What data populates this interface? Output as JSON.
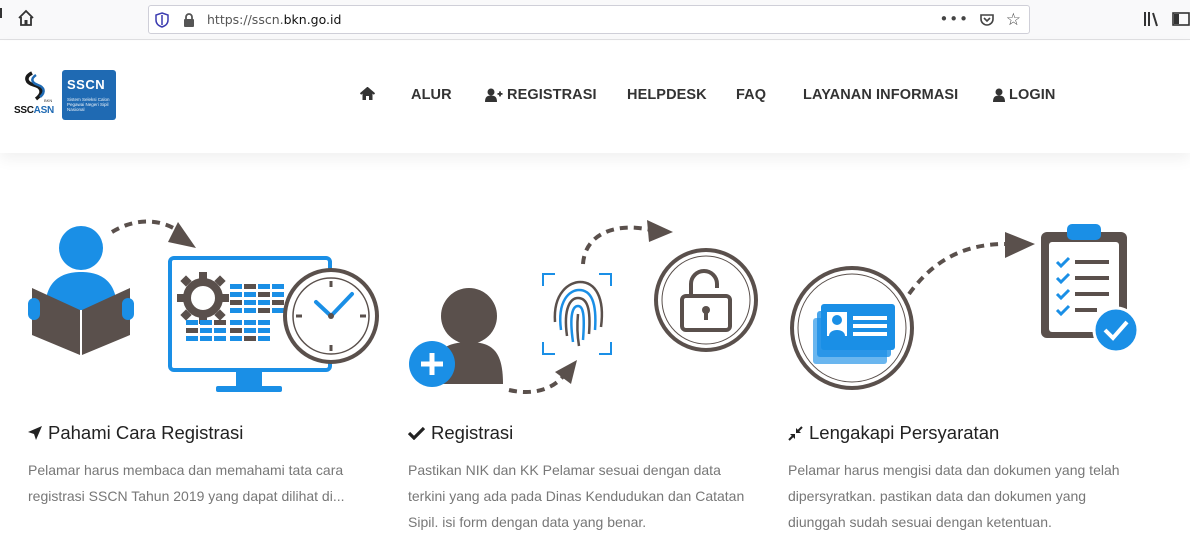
{
  "browser": {
    "url_prefix": "https://sscn.",
    "url_domain": "bkn.go.id",
    "more_label": "•••",
    "bookmark_icon": "star-icon"
  },
  "logos": {
    "sscasn_caption_left": "SSC",
    "sscasn_caption_right": "ASN",
    "sscn_title": "SSCN",
    "sscn_subtitle": "Sistem Seleksi Calon Pegawai Negeri Sipil Nasional"
  },
  "nav": {
    "home_icon": "home-icon",
    "items": [
      {
        "label": "ALUR"
      },
      {
        "label": "REGISTRASI",
        "icon": "user-plus-icon"
      },
      {
        "label": "HELPDESK"
      },
      {
        "label": "FAQ"
      },
      {
        "label": "LAYANAN INFORMASI"
      },
      {
        "label": "LOGIN",
        "icon": "user-icon"
      }
    ]
  },
  "colors": {
    "brand_blue": "#1f6ab3",
    "accent_blue": "#1a8fe6",
    "dark_gray": "#5a504c",
    "text_gray": "#777777"
  },
  "steps": [
    {
      "icon": "paper-plane-icon",
      "title": "Pahami Cara Registrasi",
      "description": "Pelamar harus membaca dan memahami tata cara registrasi SSCN Tahun 2019 yang dapat dilihat di..."
    },
    {
      "icon": "check-icon",
      "title": "Registrasi",
      "description": "Pastikan NIK dan KK Pelamar sesuai dengan data terkini yang ada pada Dinas Kendudukan dan Catatan Sipil. isi form dengan data yang benar."
    },
    {
      "icon": "compress-icon",
      "title": "Lengakapi Persyaratan",
      "description": "Pelamar harus mengisi data dan dokumen yang telah dipersyratkan. pastikan data dan dokumen yang diunggah sudah sesuai dengan ketentuan."
    }
  ]
}
